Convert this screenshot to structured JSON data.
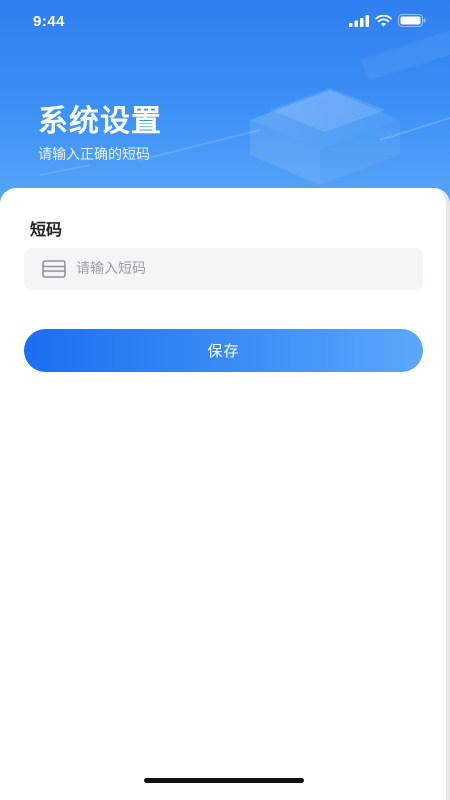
{
  "status_bar": {
    "time": "9:44",
    "icons": [
      "cellular-signal-icon",
      "wifi-icon",
      "battery-icon"
    ]
  },
  "header": {
    "title": "系统设置",
    "subtitle": "请输入正确的短码"
  },
  "form": {
    "field_label": "短码",
    "input_placeholder": "请输入短码",
    "input_value": "",
    "input_icon": "card-icon",
    "save_label": "保存"
  },
  "colors": {
    "hero_blue": "#2f7ff0",
    "button_start": "#1b6ff0",
    "button_end": "#5aa7fb",
    "card_bg": "#ffffff",
    "input_bg": "#f4f5f7"
  }
}
